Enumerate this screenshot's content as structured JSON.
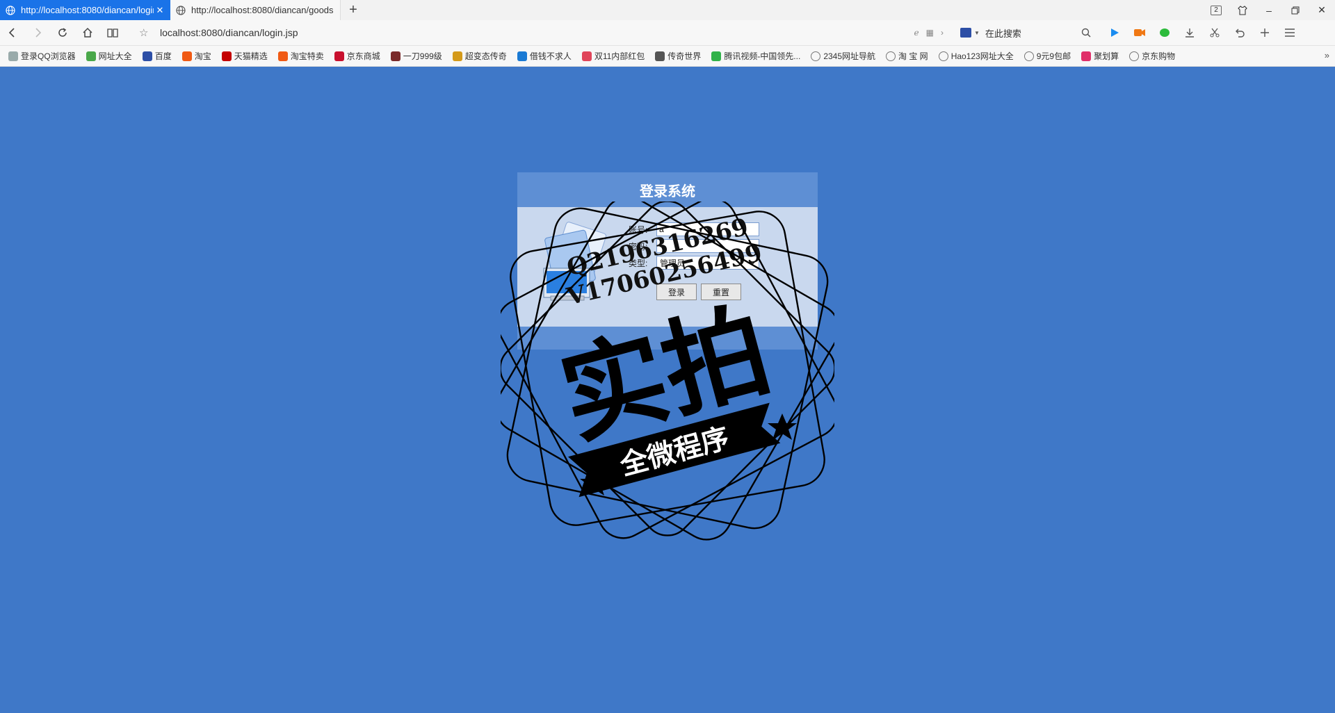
{
  "tabs": [
    {
      "title": "http://localhost:8080/diancan/login.jsp",
      "active": true
    },
    {
      "title": "http://localhost:8080/diancan/goods",
      "active": false
    }
  ],
  "window": {
    "tab_count": "2"
  },
  "address": {
    "url": "localhost:8080/diancan/login.jsp"
  },
  "search": {
    "placeholder": "在此搜索"
  },
  "bookmarks": [
    {
      "label": "登录QQ浏览器",
      "icon": "user-icon",
      "color": "#9aa"
    },
    {
      "label": "网址大全",
      "icon": "hao-icon",
      "color": "#4aa84a"
    },
    {
      "label": "百度",
      "icon": "baidu-icon",
      "color": "#2d4fa6"
    },
    {
      "label": "淘宝",
      "icon": "taobao-icon",
      "color": "#f05a14"
    },
    {
      "label": "天猫精选",
      "icon": "tmall-icon",
      "color": "#c40000"
    },
    {
      "label": "淘宝特卖",
      "icon": "taobao-sale-icon",
      "color": "#f05a14"
    },
    {
      "label": "京东商城",
      "icon": "jd-icon",
      "color": "#c8102e"
    },
    {
      "label": "一刀999级",
      "icon": "game-icon",
      "color": "#7a2a2a"
    },
    {
      "label": "超变态传奇",
      "icon": "legend-icon",
      "color": "#d49a1a"
    },
    {
      "label": "借钱不求人",
      "icon": "loan-icon",
      "color": "#1a7ad4"
    },
    {
      "label": "双11内部红包",
      "icon": "redpacket-icon",
      "color": "#e0455a"
    },
    {
      "label": "传奇世界",
      "icon": "legend-world-icon",
      "color": "#555"
    },
    {
      "label": "腾讯视频-中国领先...",
      "icon": "tencent-video-icon",
      "color": "#31b24a"
    },
    {
      "label": "2345网址导航",
      "icon": "globe-icon",
      "color": "#777"
    },
    {
      "label": "淘 宝 网",
      "icon": "globe-icon",
      "color": "#777"
    },
    {
      "label": "Hao123网址大全",
      "icon": "globe-icon",
      "color": "#777"
    },
    {
      "label": "9元9包邮",
      "icon": "globe-icon",
      "color": "#777"
    },
    {
      "label": "聚划算",
      "icon": "juhuasuan-icon",
      "color": "#e0306a"
    },
    {
      "label": "京东购物",
      "icon": "globe-icon",
      "color": "#777"
    }
  ],
  "login": {
    "title": "登录系统",
    "account_label": "账号:",
    "account_value": "a",
    "password_label": "密码:",
    "password_value": "•",
    "type_label": "类型:",
    "type_value": "管理员",
    "submit_label": "登录",
    "reset_label": "重置"
  },
  "watermark": {
    "qq": "Q2196316269",
    "wechat": "V17060256499",
    "big": "实拍",
    "ribbon": "全微程序"
  },
  "colors": {
    "page_bg": "#3f78c8",
    "panel_header": "#5e8fd4",
    "panel_body": "#c9d8ee",
    "active_tab": "#1a73e8"
  }
}
